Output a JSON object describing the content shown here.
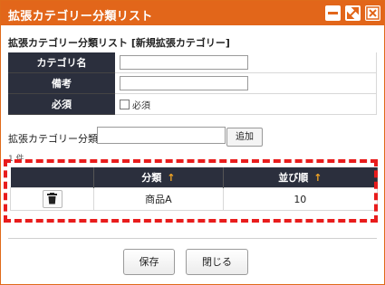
{
  "window": {
    "title": "拡張カテゴリー分類リスト",
    "colors": {
      "titlebar": "#e2661a",
      "header": "#2b2f3d",
      "highlight": "#e81c1c"
    }
  },
  "subtitle": "拡張カテゴリー分類リスト [新規拡張カテゴリー]",
  "form": {
    "rows": [
      {
        "label": "カテゴリ名",
        "value": ""
      },
      {
        "label": "備考",
        "value": ""
      },
      {
        "label": "必須",
        "checkbox_label": "必須",
        "checked": false
      }
    ]
  },
  "category_input": {
    "label": "拡張カテゴリー分類",
    "value": "",
    "add_button": "追加"
  },
  "count": "1 件",
  "grid": {
    "columns": [
      "",
      "分類",
      "並び順"
    ],
    "sort_indicator": "↑",
    "rows": [
      {
        "name": "商品A",
        "order": "10"
      }
    ]
  },
  "footer": {
    "save": "保存",
    "close": "閉じる"
  },
  "icons": [
    "minimize-icon",
    "maximize-icon",
    "close-icon",
    "trash-icon",
    "sort-arrow-icon"
  ]
}
